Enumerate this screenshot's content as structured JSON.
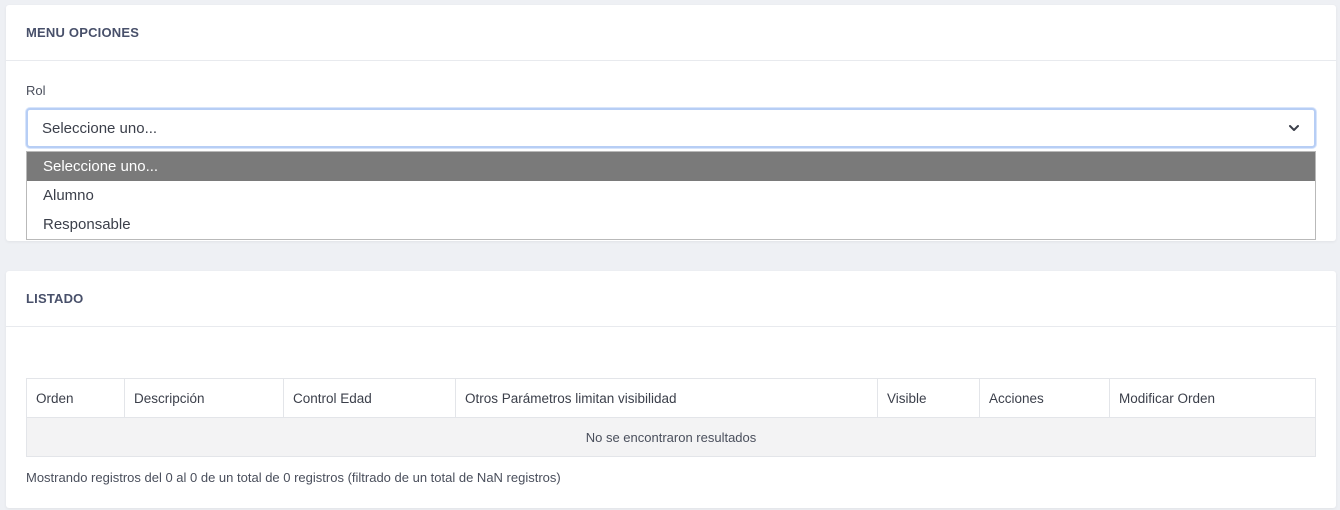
{
  "menu_card": {
    "title": "MENU OPCIONES",
    "role_label": "Rol",
    "select": {
      "value": "Seleccione uno...",
      "options": [
        "Seleccione uno...",
        "Alumno",
        "Responsable"
      ]
    }
  },
  "list_card": {
    "title": "LISTADO",
    "columns": [
      "Orden",
      "Descripción",
      "Control Edad",
      "Otros Parámetros limitan visibilidad",
      "Visible",
      "Acciones",
      "Modificar Orden"
    ],
    "empty_message": "No se encontraron resultados",
    "info": "Mostrando registros del 0 al 0 de un total de 0 registros (filtrado de un total de NaN registros)"
  },
  "icons": {
    "select_arrow": "chevron-down-icon"
  },
  "colors": {
    "selected_option_bg": "#7a7a7a",
    "focus_border": "#b7cef5"
  }
}
